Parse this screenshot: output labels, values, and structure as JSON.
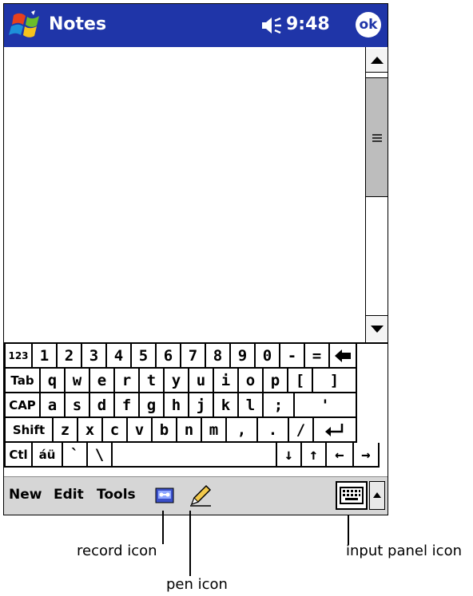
{
  "titlebar": {
    "app_title": "Notes",
    "time": "9:48",
    "ok_label": "ok",
    "colors": {
      "background": "#1f35a8",
      "text": "#ffffff"
    }
  },
  "keyboard": {
    "rows": [
      {
        "keys": [
          "123",
          "1",
          "2",
          "3",
          "4",
          "5",
          "6",
          "7",
          "8",
          "9",
          "0",
          "-",
          "=",
          "backspace-icon"
        ]
      },
      {
        "keys": [
          "Tab",
          "q",
          "w",
          "e",
          "r",
          "t",
          "y",
          "u",
          "i",
          "o",
          "p",
          "[",
          "]"
        ]
      },
      {
        "keys": [
          "CAP",
          "a",
          "s",
          "d",
          "f",
          "g",
          "h",
          "j",
          "k",
          "l",
          ";",
          "'"
        ]
      },
      {
        "keys": [
          "Shift",
          "z",
          "x",
          "c",
          "v",
          "b",
          "n",
          "m",
          ",",
          ".",
          "/",
          "enter-icon"
        ]
      },
      {
        "keys": [
          "Ctl",
          "áü",
          "`",
          "\\",
          "space",
          "↓",
          "↑",
          "←",
          "→"
        ]
      }
    ]
  },
  "menubar": {
    "items": [
      "New",
      "Edit",
      "Tools"
    ],
    "icons": [
      "record-icon",
      "pen-icon",
      "keyboard-icon",
      "chevron-up-icon"
    ]
  },
  "callouts": {
    "record": "record icon",
    "pen": "pen icon",
    "input_panel": "input panel icon"
  }
}
